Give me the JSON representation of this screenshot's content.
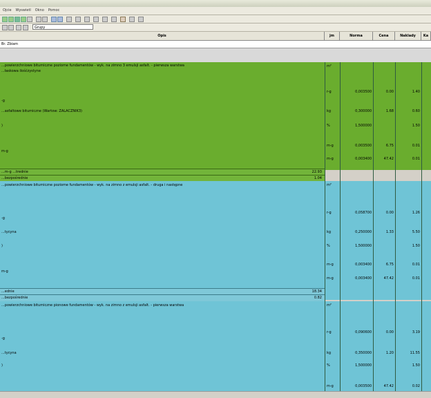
{
  "menu": [
    "Ojcie",
    "Wyswietl",
    "Okno",
    "Pomoc"
  ],
  "toolbar": {
    "combo_value": "Grupy"
  },
  "header": {
    "opis": "Opis",
    "jm": "jm",
    "norma": "Norma",
    "cena": "Cena",
    "naklady": "Naklady",
    "ka": "Ka"
  },
  "namebar": "Br. Zbiam",
  "green": {
    "title1": "...powierzchniowe bitumiczne poziome fundamentów - wyk. na zimno 3 emulsji asfalt. - pierwsza warstwa",
    "title2": "...łaskowa ilośćzystyne",
    "jm_title": "m²",
    "rows": [
      {
        "label": "-g",
        "jm": "r-g",
        "norma": "0,003500",
        "cena": "0.00",
        "naklady": "1.40"
      },
      {
        "label": "...asfaltowe bitumiczne (Wartow: ZALACZNIK3)",
        "jm": "kg",
        "norma": "0,300000",
        "cena": "1.68",
        "naklady": "0.60"
      },
      {
        "label": ")",
        "jm": "%",
        "norma": "1,500000",
        "cena": "",
        "naklady": "1.50"
      },
      {
        "label": "m-g",
        "jm": "m-g",
        "norma": "0,003500",
        "cena": "6.75",
        "naklady": "0.01"
      },
      {
        "label": "",
        "jm": "m-g",
        "norma": "0,003400",
        "cena": "47.42",
        "naklady": "0.01"
      }
    ],
    "sum1_label": "...m-g\n...trednie",
    "sum1_value": "22.93",
    "sum2_label": "...bezpośrednie",
    "sum2_value": "1.04"
  },
  "blue1": {
    "title1": "...powierzchniowe bitumiczne poziome fundamentów - wyk. na zimno z emulsji asfalt. - druga i następne",
    "jm_title": "m²",
    "rows": [
      {
        "label": "-g",
        "jm": "r-g",
        "norma": "0,058700",
        "cena": "0.00",
        "naklady": "1.26"
      },
      {
        "label": "...tycyna",
        "jm": "kg",
        "norma": "0,250000",
        "cena": "1.33",
        "naklady": "5.50"
      },
      {
        "label": ")",
        "jm": "%",
        "norma": "1,500000",
        "cena": "",
        "naklady": "1.50"
      },
      {
        "label": "m-g",
        "jm": "m-g",
        "norma": "0,003400",
        "cena": "6.75",
        "naklady": "0.01"
      },
      {
        "label": "",
        "jm": "m-g",
        "norma": "0,003400",
        "cena": "47.42",
        "naklady": "0.01"
      }
    ],
    "sum1_label": "...ednie",
    "sum1_value": "18.34",
    "sum2_label": "...bezpośrednie",
    "sum2_value": "0.82"
  },
  "blue2": {
    "title1": "...powierzchniowe bitumiczne pionowe fundamentów - wyk. na zimno z emulsji asfalt. - pierwsza warstwa",
    "jm_title": "m²",
    "rows": [
      {
        "label": "",
        "jm": "r-g",
        "norma": "0,090600",
        "cena": "0.00",
        "naklady": "3.19"
      },
      {
        "label": "-g",
        "jm": "",
        "norma": "",
        "cena": "",
        "naklady": ""
      },
      {
        "label": "...tycyna",
        "jm": "kg",
        "norma": "0,350000",
        "cena": "1.20",
        "naklady": "11.55"
      },
      {
        "label": ")",
        "jm": "%",
        "norma": "1,500000",
        "cena": "",
        "naklady": "1.50"
      },
      {
        "label": "",
        "jm": "m-g",
        "norma": "0,003500",
        "cena": "47.42",
        "naklady": "0.02"
      }
    ]
  }
}
